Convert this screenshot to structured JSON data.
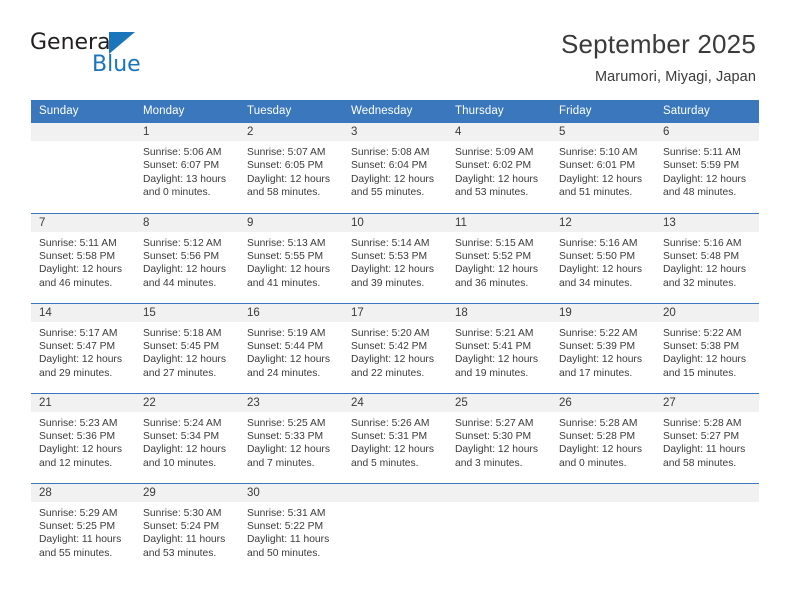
{
  "brand": {
    "name_part1": "General",
    "name_part2": "Blue",
    "logo_icon": "triangle-icon",
    "accent_color": "#1b75bb"
  },
  "header": {
    "title": "September 2025",
    "location": "Marumori, Miyagi, Japan"
  },
  "theme": {
    "header_bg": "#3a77bd",
    "daynum_bg": "#f1f1f1",
    "text": "#3b3b3b",
    "divider": "#3a77bd"
  },
  "weekdays": [
    "Sunday",
    "Monday",
    "Tuesday",
    "Wednesday",
    "Thursday",
    "Friday",
    "Saturday"
  ],
  "weeks": [
    [
      {
        "day": "",
        "sunrise": "",
        "sunset": "",
        "daylight1": "",
        "daylight2": ""
      },
      {
        "day": "1",
        "sunrise": "Sunrise: 5:06 AM",
        "sunset": "Sunset: 6:07 PM",
        "daylight1": "Daylight: 13 hours",
        "daylight2": "and 0 minutes."
      },
      {
        "day": "2",
        "sunrise": "Sunrise: 5:07 AM",
        "sunset": "Sunset: 6:05 PM",
        "daylight1": "Daylight: 12 hours",
        "daylight2": "and 58 minutes."
      },
      {
        "day": "3",
        "sunrise": "Sunrise: 5:08 AM",
        "sunset": "Sunset: 6:04 PM",
        "daylight1": "Daylight: 12 hours",
        "daylight2": "and 55 minutes."
      },
      {
        "day": "4",
        "sunrise": "Sunrise: 5:09 AM",
        "sunset": "Sunset: 6:02 PM",
        "daylight1": "Daylight: 12 hours",
        "daylight2": "and 53 minutes."
      },
      {
        "day": "5",
        "sunrise": "Sunrise: 5:10 AM",
        "sunset": "Sunset: 6:01 PM",
        "daylight1": "Daylight: 12 hours",
        "daylight2": "and 51 minutes."
      },
      {
        "day": "6",
        "sunrise": "Sunrise: 5:11 AM",
        "sunset": "Sunset: 5:59 PM",
        "daylight1": "Daylight: 12 hours",
        "daylight2": "and 48 minutes."
      }
    ],
    [
      {
        "day": "7",
        "sunrise": "Sunrise: 5:11 AM",
        "sunset": "Sunset: 5:58 PM",
        "daylight1": "Daylight: 12 hours",
        "daylight2": "and 46 minutes."
      },
      {
        "day": "8",
        "sunrise": "Sunrise: 5:12 AM",
        "sunset": "Sunset: 5:56 PM",
        "daylight1": "Daylight: 12 hours",
        "daylight2": "and 44 minutes."
      },
      {
        "day": "9",
        "sunrise": "Sunrise: 5:13 AM",
        "sunset": "Sunset: 5:55 PM",
        "daylight1": "Daylight: 12 hours",
        "daylight2": "and 41 minutes."
      },
      {
        "day": "10",
        "sunrise": "Sunrise: 5:14 AM",
        "sunset": "Sunset: 5:53 PM",
        "daylight1": "Daylight: 12 hours",
        "daylight2": "and 39 minutes."
      },
      {
        "day": "11",
        "sunrise": "Sunrise: 5:15 AM",
        "sunset": "Sunset: 5:52 PM",
        "daylight1": "Daylight: 12 hours",
        "daylight2": "and 36 minutes."
      },
      {
        "day": "12",
        "sunrise": "Sunrise: 5:16 AM",
        "sunset": "Sunset: 5:50 PM",
        "daylight1": "Daylight: 12 hours",
        "daylight2": "and 34 minutes."
      },
      {
        "day": "13",
        "sunrise": "Sunrise: 5:16 AM",
        "sunset": "Sunset: 5:48 PM",
        "daylight1": "Daylight: 12 hours",
        "daylight2": "and 32 minutes."
      }
    ],
    [
      {
        "day": "14",
        "sunrise": "Sunrise: 5:17 AM",
        "sunset": "Sunset: 5:47 PM",
        "daylight1": "Daylight: 12 hours",
        "daylight2": "and 29 minutes."
      },
      {
        "day": "15",
        "sunrise": "Sunrise: 5:18 AM",
        "sunset": "Sunset: 5:45 PM",
        "daylight1": "Daylight: 12 hours",
        "daylight2": "and 27 minutes."
      },
      {
        "day": "16",
        "sunrise": "Sunrise: 5:19 AM",
        "sunset": "Sunset: 5:44 PM",
        "daylight1": "Daylight: 12 hours",
        "daylight2": "and 24 minutes."
      },
      {
        "day": "17",
        "sunrise": "Sunrise: 5:20 AM",
        "sunset": "Sunset: 5:42 PM",
        "daylight1": "Daylight: 12 hours",
        "daylight2": "and 22 minutes."
      },
      {
        "day": "18",
        "sunrise": "Sunrise: 5:21 AM",
        "sunset": "Sunset: 5:41 PM",
        "daylight1": "Daylight: 12 hours",
        "daylight2": "and 19 minutes."
      },
      {
        "day": "19",
        "sunrise": "Sunrise: 5:22 AM",
        "sunset": "Sunset: 5:39 PM",
        "daylight1": "Daylight: 12 hours",
        "daylight2": "and 17 minutes."
      },
      {
        "day": "20",
        "sunrise": "Sunrise: 5:22 AM",
        "sunset": "Sunset: 5:38 PM",
        "daylight1": "Daylight: 12 hours",
        "daylight2": "and 15 minutes."
      }
    ],
    [
      {
        "day": "21",
        "sunrise": "Sunrise: 5:23 AM",
        "sunset": "Sunset: 5:36 PM",
        "daylight1": "Daylight: 12 hours",
        "daylight2": "and 12 minutes."
      },
      {
        "day": "22",
        "sunrise": "Sunrise: 5:24 AM",
        "sunset": "Sunset: 5:34 PM",
        "daylight1": "Daylight: 12 hours",
        "daylight2": "and 10 minutes."
      },
      {
        "day": "23",
        "sunrise": "Sunrise: 5:25 AM",
        "sunset": "Sunset: 5:33 PM",
        "daylight1": "Daylight: 12 hours",
        "daylight2": "and 7 minutes."
      },
      {
        "day": "24",
        "sunrise": "Sunrise: 5:26 AM",
        "sunset": "Sunset: 5:31 PM",
        "daylight1": "Daylight: 12 hours",
        "daylight2": "and 5 minutes."
      },
      {
        "day": "25",
        "sunrise": "Sunrise: 5:27 AM",
        "sunset": "Sunset: 5:30 PM",
        "daylight1": "Daylight: 12 hours",
        "daylight2": "and 3 minutes."
      },
      {
        "day": "26",
        "sunrise": "Sunrise: 5:28 AM",
        "sunset": "Sunset: 5:28 PM",
        "daylight1": "Daylight: 12 hours",
        "daylight2": "and 0 minutes."
      },
      {
        "day": "27",
        "sunrise": "Sunrise: 5:28 AM",
        "sunset": "Sunset: 5:27 PM",
        "daylight1": "Daylight: 11 hours",
        "daylight2": "and 58 minutes."
      }
    ],
    [
      {
        "day": "28",
        "sunrise": "Sunrise: 5:29 AM",
        "sunset": "Sunset: 5:25 PM",
        "daylight1": "Daylight: 11 hours",
        "daylight2": "and 55 minutes."
      },
      {
        "day": "29",
        "sunrise": "Sunrise: 5:30 AM",
        "sunset": "Sunset: 5:24 PM",
        "daylight1": "Daylight: 11 hours",
        "daylight2": "and 53 minutes."
      },
      {
        "day": "30",
        "sunrise": "Sunrise: 5:31 AM",
        "sunset": "Sunset: 5:22 PM",
        "daylight1": "Daylight: 11 hours",
        "daylight2": "and 50 minutes."
      },
      {
        "day": "",
        "sunrise": "",
        "sunset": "",
        "daylight1": "",
        "daylight2": ""
      },
      {
        "day": "",
        "sunrise": "",
        "sunset": "",
        "daylight1": "",
        "daylight2": ""
      },
      {
        "day": "",
        "sunrise": "",
        "sunset": "",
        "daylight1": "",
        "daylight2": ""
      },
      {
        "day": "",
        "sunrise": "",
        "sunset": "",
        "daylight1": "",
        "daylight2": ""
      }
    ]
  ]
}
